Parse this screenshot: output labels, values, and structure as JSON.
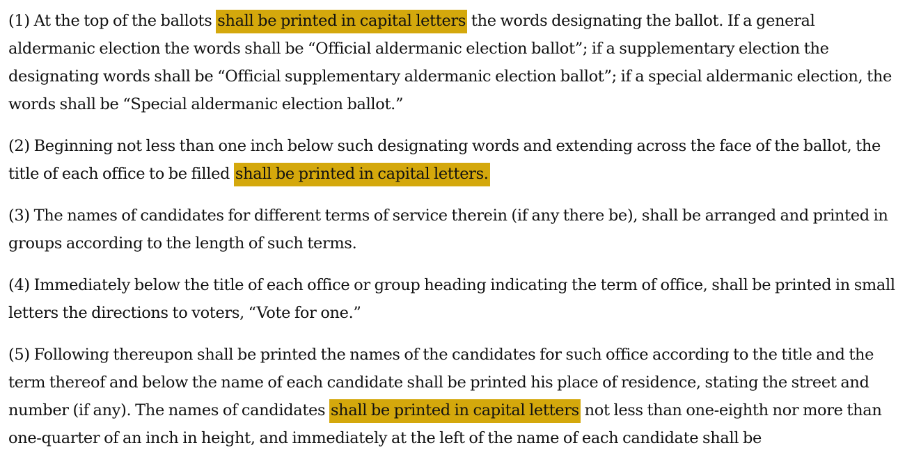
{
  "colors": {
    "highlight": "#d4a80c",
    "text": "#111111",
    "background": "#ffffff"
  },
  "paragraphs": [
    {
      "segments": [
        {
          "text": "(1)  At the top of the ballots ",
          "highlight": false
        },
        {
          "text": "shall be printed in capital letters",
          "highlight": true
        },
        {
          "text": " the words designating the ballot.   If a general aldermanic election the words shall be “Official aldermanic election ballot”;  if a supplementary election the designating words shall be “Official supplementary aldermanic election ballot”;  if a special aldermanic election, the words shall be “Special aldermanic election ballot.”",
          "highlight": false
        }
      ]
    },
    {
      "segments": [
        {
          "text": "(2)  Beginning not less than one inch below such designating words and extending across the face of the ballot, the title of each office to be filled ",
          "highlight": false
        },
        {
          "text": "shall be printed in capital letters.",
          "highlight": true
        }
      ]
    },
    {
      "segments": [
        {
          "text": "(3)  The names of candidates for different terms of service therein (if any there be), shall be arranged and printed in groups according to the length of such terms.",
          "highlight": false
        }
      ]
    },
    {
      "segments": [
        {
          "text": "(4)  Immediately below the title of each office or group heading indicating the term of office, shall be printed in small letters the directions to voters, “Vote for one.”",
          "highlight": false
        }
      ]
    },
    {
      "segments": [
        {
          "text": "(5)  Following thereupon shall be printed the names of the candidates for such office according to the title and the term thereof and below the name of each candidate shall be printed his place of residence, stating the street and number (if any).   The names of candidates ",
          "highlight": false
        },
        {
          "text": "shall be printed in capital letters",
          "highlight": true
        },
        {
          "text": " not less than one-eighth nor more than one-quarter of an inch in height, and immediately at the left of the name of each candidate shall be",
          "highlight": false
        }
      ]
    }
  ]
}
